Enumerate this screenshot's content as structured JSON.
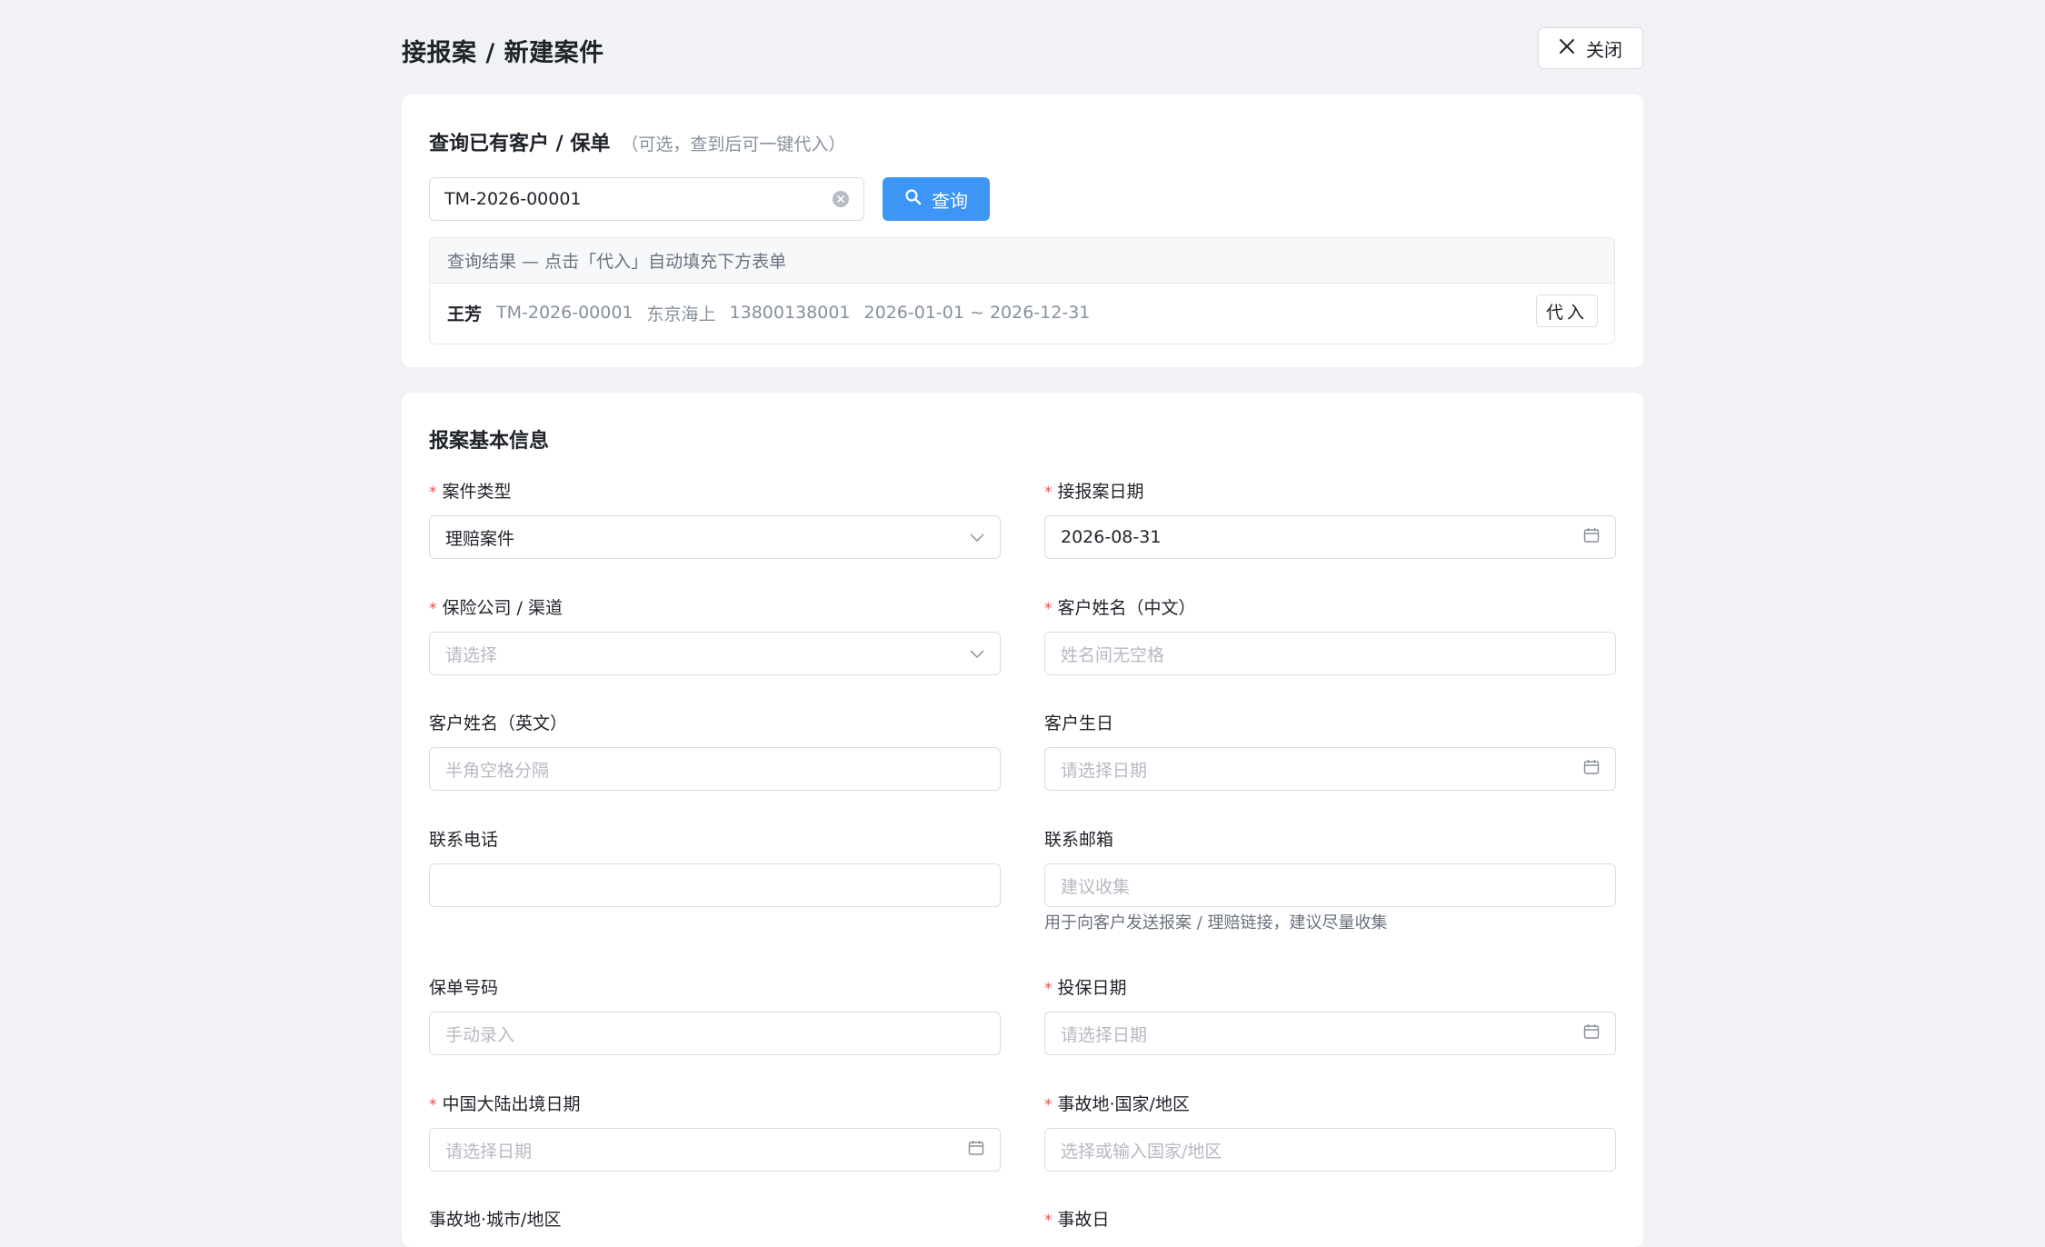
{
  "header": {
    "title": "接报案 / 新建案件",
    "close_label": "关闭"
  },
  "search_card": {
    "title": "查询已有客户 / 保单",
    "subtitle": "（可选，查到后可一键代入）",
    "input_value": "TM-2026-00001",
    "query_label": "查询",
    "results_header": "查询结果 — 点击「代入」自动填充下方表单",
    "results": [
      {
        "name": "王芳",
        "policy_no": "TM-2026-00001",
        "insurer": "东京海上",
        "phone": "13800138001",
        "period": "2026-01-01 ~ 2026-12-31",
        "action_label": "代入"
      }
    ]
  },
  "form_card": {
    "title": "报案基本信息",
    "fields": {
      "case_type": {
        "label": "案件类型",
        "required": true,
        "value": "理赔案件",
        "placeholder": ""
      },
      "report_date": {
        "label": "接报案日期",
        "required": true,
        "value": "2026-08-31",
        "placeholder": ""
      },
      "insurer_channel": {
        "label": "保险公司 / 渠道",
        "required": true,
        "value": "",
        "placeholder": "请选择"
      },
      "name_cn": {
        "label": "客户姓名（中文）",
        "required": true,
        "value": "",
        "placeholder": "姓名间无空格"
      },
      "name_en": {
        "label": "客户姓名（英文）",
        "required": false,
        "value": "",
        "placeholder": "半角空格分隔"
      },
      "birthday": {
        "label": "客户生日",
        "required": false,
        "value": "",
        "placeholder": "请选择日期"
      },
      "phone": {
        "label": "联系电话",
        "required": false,
        "value": "",
        "placeholder": ""
      },
      "email": {
        "label": "联系邮箱",
        "required": false,
        "value": "",
        "placeholder": "建议收集",
        "help": "用于向客户发送报案 / 理赔链接，建议尽量收集"
      },
      "policy_no": {
        "label": "保单号码",
        "required": false,
        "value": "",
        "placeholder": "手动录入"
      },
      "policy_date": {
        "label": "投保日期",
        "required": true,
        "value": "",
        "placeholder": "请选择日期"
      },
      "departure_date": {
        "label": "中国大陆出境日期",
        "required": true,
        "value": "",
        "placeholder": "请选择日期"
      },
      "accident_country": {
        "label": "事故地·国家/地区",
        "required": true,
        "value": "",
        "placeholder": "选择或输入国家/地区"
      },
      "accident_city": {
        "label": "事故地·城市/地区",
        "required": false,
        "value": "",
        "placeholder": ""
      },
      "accident_day": {
        "label": "事故日",
        "required": true,
        "value": "",
        "placeholder": ""
      }
    },
    "required_mark": "*"
  },
  "colors": {
    "primary": "#3d95f5",
    "required": "#f54a45",
    "background": "#f0f2f5"
  }
}
